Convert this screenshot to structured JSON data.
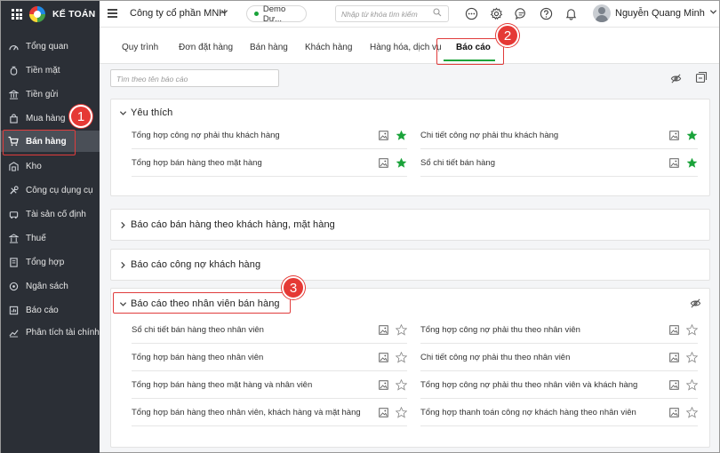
{
  "app": {
    "brand": "KẾ TOÁN"
  },
  "sidebar": {
    "items": [
      {
        "label": "Tổng quan",
        "icon": "dashboard-icon"
      },
      {
        "label": "Tiền mặt",
        "icon": "cash-icon"
      },
      {
        "label": "Tiền gửi",
        "icon": "bank-icon"
      },
      {
        "label": "Mua hàng",
        "icon": "bag-icon"
      },
      {
        "label": "Bán hàng",
        "icon": "cart-icon",
        "active": true
      },
      {
        "label": "Kho",
        "icon": "warehouse-icon"
      },
      {
        "label": "Công cụ dụng cụ",
        "icon": "tools-icon"
      },
      {
        "label": "Tài sản cố định",
        "icon": "asset-icon"
      },
      {
        "label": "Thuế",
        "icon": "tax-icon"
      },
      {
        "label": "Tổng hợp",
        "icon": "summary-icon"
      },
      {
        "label": "Ngân sách",
        "icon": "budget-icon"
      },
      {
        "label": "Báo cáo",
        "icon": "report-icon"
      },
      {
        "label": "Phân tích tài chính",
        "icon": "analytics-icon"
      }
    ]
  },
  "topbar": {
    "company": "Công ty cổ phần MNH",
    "demo": "Demo Dư...",
    "search_placeholder": "Nhập từ khóa tìm kiếm",
    "user_name": "Nguyễn Quang Minh"
  },
  "tabs": [
    {
      "label": "Quy trình"
    },
    {
      "label": "Đơn đặt hàng"
    },
    {
      "label": "Bán hàng"
    },
    {
      "label": "Khách hàng"
    },
    {
      "label": "Hàng hóa, dịch vụ"
    },
    {
      "label": "Báo cáo",
      "active": true
    }
  ],
  "report_search_placeholder": "Tìm theo tên báo cáo",
  "callouts": [
    "1",
    "2",
    "3"
  ],
  "sections": {
    "favorites": {
      "title": "Yêu thích",
      "rows": [
        {
          "left": "Tổng hợp công nợ phải thu khách hàng",
          "right": "Chi tiết công nợ phải thu khách hàng"
        },
        {
          "left": "Tổng hợp bán hàng theo mặt hàng",
          "right": "Sổ chi tiết bán hàng"
        }
      ]
    },
    "by_customer": {
      "title": "Báo cáo bán hàng theo khách hàng, mặt hàng"
    },
    "customer_debt": {
      "title": "Báo cáo công nợ khách hàng"
    },
    "by_staff": {
      "title": "Báo cáo theo nhân viên bán hàng",
      "rows": [
        {
          "left": "Sổ chi tiết bán hàng theo nhân viên",
          "right": "Tổng hợp công nợ phải thu theo nhân viên"
        },
        {
          "left": "Tổng hợp bán hàng theo nhân viên",
          "right": "Chi tiết công nợ phải thu theo nhân viên"
        },
        {
          "left": "Tổng hợp bán hàng theo mặt hàng và nhân viên",
          "right": "Tổng hợp công nợ phải thu theo nhân viên và khách hàng"
        },
        {
          "left": "Tổng hợp bán hàng theo nhân viên, khách hàng và mặt hàng",
          "right": "Tổng hợp thanh toán công nợ khách hàng theo nhân viên"
        }
      ]
    }
  },
  "colors": {
    "accent": "#1aa33a",
    "sidebar": "#2b2f36",
    "callout": "#e53935"
  }
}
